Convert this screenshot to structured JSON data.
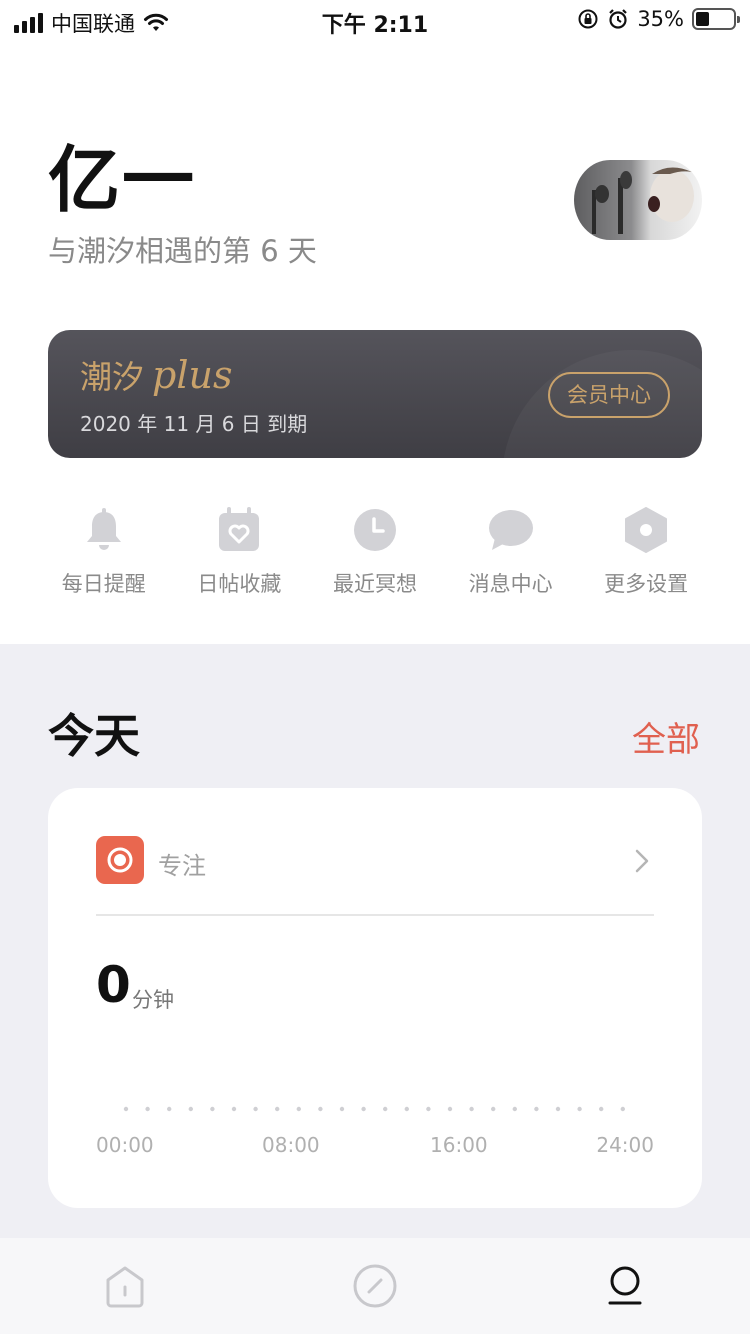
{
  "status_bar": {
    "carrier": "中国联通",
    "time": "下午 2:11",
    "battery": "35%",
    "battery_level": 0.35
  },
  "profile": {
    "name": "亿一",
    "subtitle": "与潮汐相遇的第 6 天"
  },
  "plus": {
    "title": "潮汐",
    "title_script": "plus",
    "expiry": "2020 年 11 月 6 日 到期",
    "member_button": "会员中心"
  },
  "actions": [
    {
      "label": "每日提醒",
      "icon": "bell-icon"
    },
    {
      "label": "日帖收藏",
      "icon": "calendar-heart-icon"
    },
    {
      "label": "最近冥想",
      "icon": "clock-icon"
    },
    {
      "label": "消息中心",
      "icon": "chat-bubble-icon"
    },
    {
      "label": "更多设置",
      "icon": "hexagon-settings-icon"
    }
  ],
  "today": {
    "title": "今天",
    "all_link": "全部"
  },
  "focus": {
    "label": "专注",
    "value": "0",
    "unit": "分钟",
    "ticks": [
      "00:00",
      "08:00",
      "16:00",
      "24:00"
    ]
  },
  "tabs": [
    {
      "name": "home",
      "icon": "home-icon",
      "active": false
    },
    {
      "name": "discover",
      "icon": "compass-icon",
      "active": false
    },
    {
      "name": "profile",
      "icon": "user-icon",
      "active": true
    }
  ],
  "colors": {
    "accent_red": "#e0604f",
    "focus_orange": "#e9674f",
    "gold": "#c9a26b",
    "card_dark": "#48474d",
    "icon_gray": "#d2d2d6"
  }
}
